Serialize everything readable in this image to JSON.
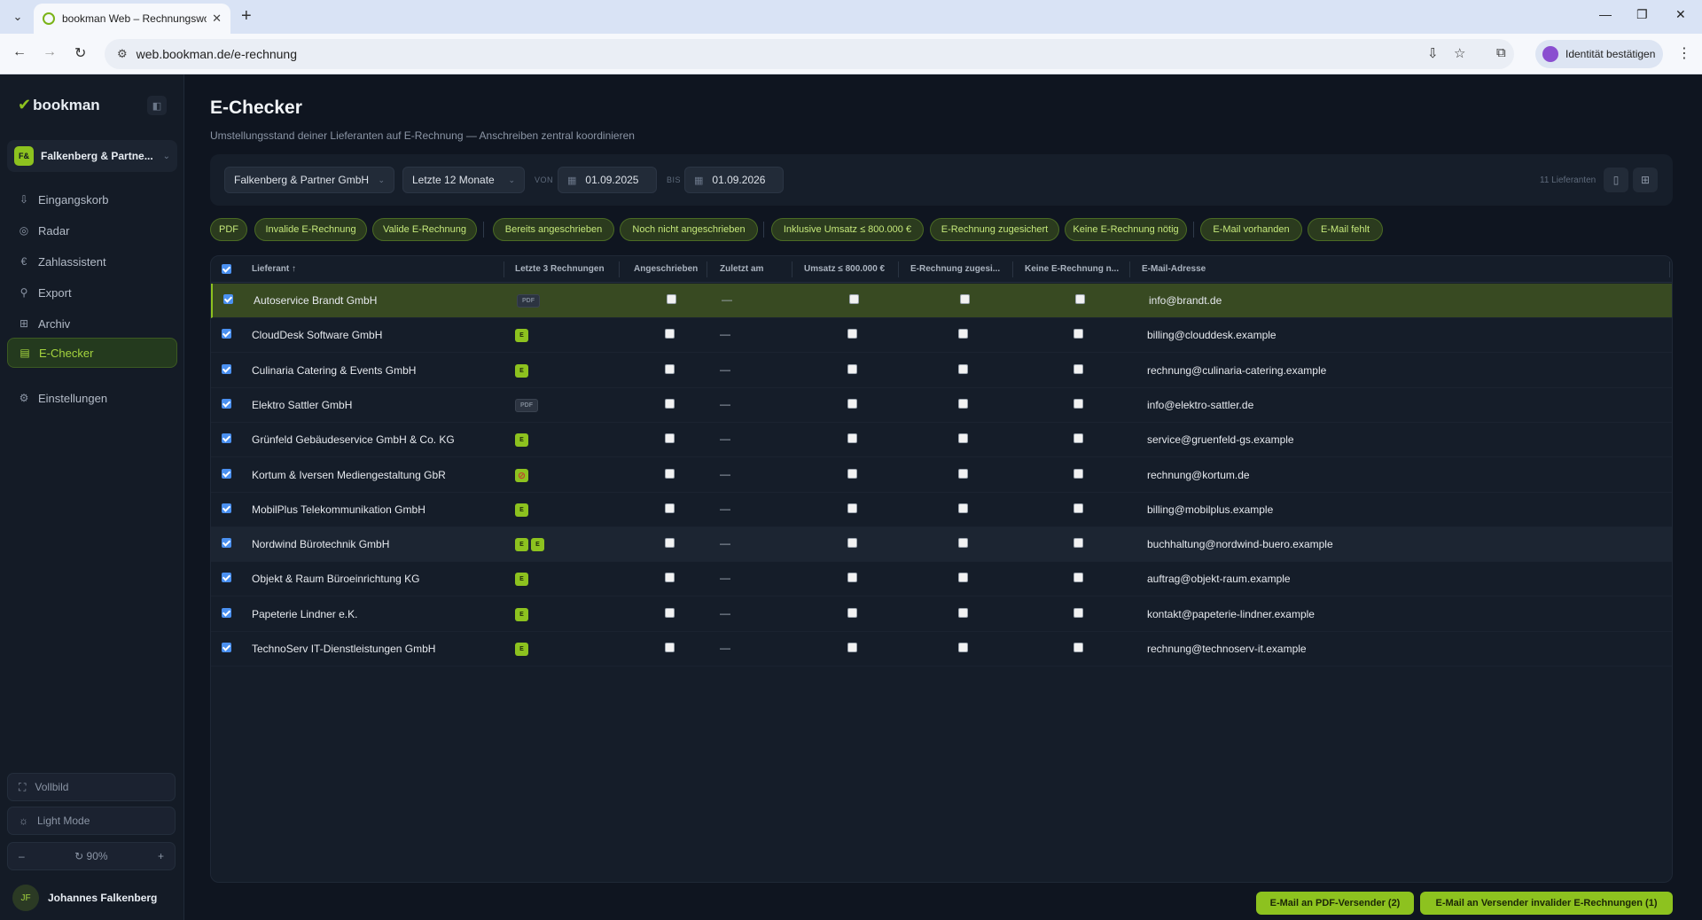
{
  "browser": {
    "tab_title": "bookman Web – Rechnungsworkfl",
    "url": "web.bookman.de/e-rechnung",
    "identity_button": "Identität bestätigen"
  },
  "sidebar": {
    "logo": "bookman",
    "org_badge": "F&",
    "org_name": "Falkenberg & Partne...",
    "items": [
      {
        "label": "Eingangskorb",
        "icon": "inbox-icon"
      },
      {
        "label": "Radar",
        "icon": "radar-icon"
      },
      {
        "label": "Zahlassistent",
        "icon": "euro-icon"
      },
      {
        "label": "Export",
        "icon": "export-icon"
      },
      {
        "label": "Archiv",
        "icon": "archive-icon"
      },
      {
        "label": "E-Checker",
        "icon": "document-check-icon",
        "active": true
      },
      {
        "label": "Einstellungen",
        "icon": "gear-icon"
      }
    ],
    "fullscreen_label": "Vollbild",
    "lightmode_label": "Light Mode",
    "zoom_minus": "–",
    "zoom_value": "90%",
    "zoom_plus": "+",
    "user_initials": "JF",
    "user_name": "Johannes Falkenberg"
  },
  "main": {
    "title": "E-Checker",
    "subtitle": "Umstellungsstand deiner Lieferanten auf E-Rechnung — Anschreiben zentral koordinieren",
    "filters": {
      "company": "Falkenberg & Partner GmbH",
      "period": "Letzte 12 Monate",
      "von_label": "VON",
      "from_date": "01.09.2025",
      "bis_label": "BIS",
      "to_date": "01.09.2026",
      "count": "11 Lieferanten"
    },
    "chips": [
      "PDF",
      "Invalide E-Rechnung",
      "Valide E-Rechnung",
      "Bereits angeschrieben",
      "Noch nicht angeschrieben",
      "Inklusive Umsatz ≤ 800.000 €",
      "E-Rechnung zugesichert",
      "Keine E-Rechnung nötig",
      "E-Mail vorhanden",
      "E-Mail fehlt"
    ],
    "columns": [
      "Lieferant ↑",
      "Letzte 3 Rechnungen",
      "Angeschrieben",
      "Zuletzt am",
      "Umsatz ≤ 800.000 €",
      "E-Rechnung zugesi...",
      "Keine E-Rechnung n...",
      "E-Mail-Adresse"
    ],
    "rows": [
      {
        "name": "Autoservice Brandt GmbH",
        "invoices": [
          "PDF"
        ],
        "last": "—",
        "email": "info@brandt.de"
      },
      {
        "name": "CloudDesk Software GmbH",
        "invoices": [
          "E"
        ],
        "last": "—",
        "email": "billing@clouddesk.example"
      },
      {
        "name": "Culinaria Catering & Events GmbH",
        "invoices": [
          "E"
        ],
        "last": "—",
        "email": "rechnung@culinaria-catering.example"
      },
      {
        "name": "Elektro Sattler GmbH",
        "invoices": [
          "PDF"
        ],
        "last": "—",
        "email": "info@elektro-sattler.de"
      },
      {
        "name": "Grünfeld Gebäudeservice GmbH & Co. KG",
        "invoices": [
          "E"
        ],
        "last": "—",
        "email": "service@gruenfeld-gs.example"
      },
      {
        "name": "Kortum & Iversen Mediengestaltung GbR",
        "invoices": [
          "INVALID"
        ],
        "last": "—",
        "email": "rechnung@kortum.de"
      },
      {
        "name": "MobilPlus Telekommunikation GmbH",
        "invoices": [
          "E"
        ],
        "last": "—",
        "email": "billing@mobilplus.example"
      },
      {
        "name": "Nordwind Bürotechnik GmbH",
        "invoices": [
          "E",
          "E"
        ],
        "last": "—",
        "email": "buchhaltung@nordwind-buero.example"
      },
      {
        "name": "Objekt & Raum Büroeinrichtung KG",
        "invoices": [
          "E"
        ],
        "last": "—",
        "email": "auftrag@objekt-raum.example"
      },
      {
        "name": "Papeterie Lindner e.K.",
        "invoices": [
          "E"
        ],
        "last": "—",
        "email": "kontakt@papeterie-lindner.example"
      },
      {
        "name": "TechnoServ IT-Dienstleistungen GmbH",
        "invoices": [
          "E"
        ],
        "last": "—",
        "email": "rechnung@technoserv-it.example"
      }
    ],
    "buttons": {
      "pdf_sender": "E-Mail an PDF-Versender (2)",
      "invalid_sender": "E-Mail an Versender invalider E-Rechnungen (1)"
    }
  },
  "colors": {
    "accent": "#8dc21f",
    "background": "#0f1520",
    "selected_row": "#384a22"
  }
}
